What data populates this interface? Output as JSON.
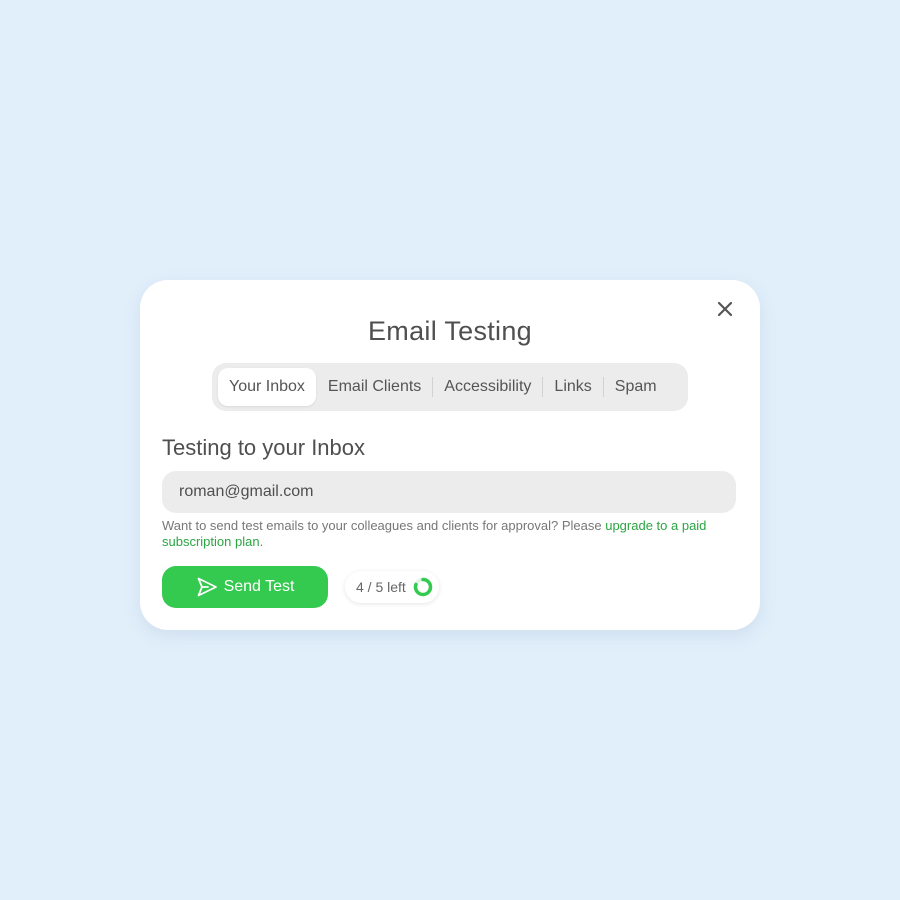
{
  "modal": {
    "title": "Email Testing",
    "close_label": "×"
  },
  "tabs": [
    {
      "label": "Your Inbox",
      "active": true
    },
    {
      "label": "Email Clients",
      "active": false
    },
    {
      "label": "Accessibility",
      "active": false
    },
    {
      "label": "Links",
      "active": false
    },
    {
      "label": "Spam",
      "active": false
    }
  ],
  "inbox": {
    "heading": "Testing to your Inbox",
    "email_value": "roman@gmail.com",
    "note_text": "Want to send test emails to your colleagues and clients for approval? Please ",
    "note_link": "upgrade to a paid subscription plan",
    "note_end": ".",
    "send_button": "Send Test",
    "quota_text": "4 / 5 left",
    "quota_used": 4,
    "quota_total": 5
  },
  "colors": {
    "background": "#e1effb",
    "accent": "#34c94f",
    "link": "#2ba541",
    "ring_track": "#dff3e3"
  },
  "icons": {
    "close": "close-icon",
    "send": "paper-plane-icon",
    "quota": "progress-ring-icon"
  }
}
